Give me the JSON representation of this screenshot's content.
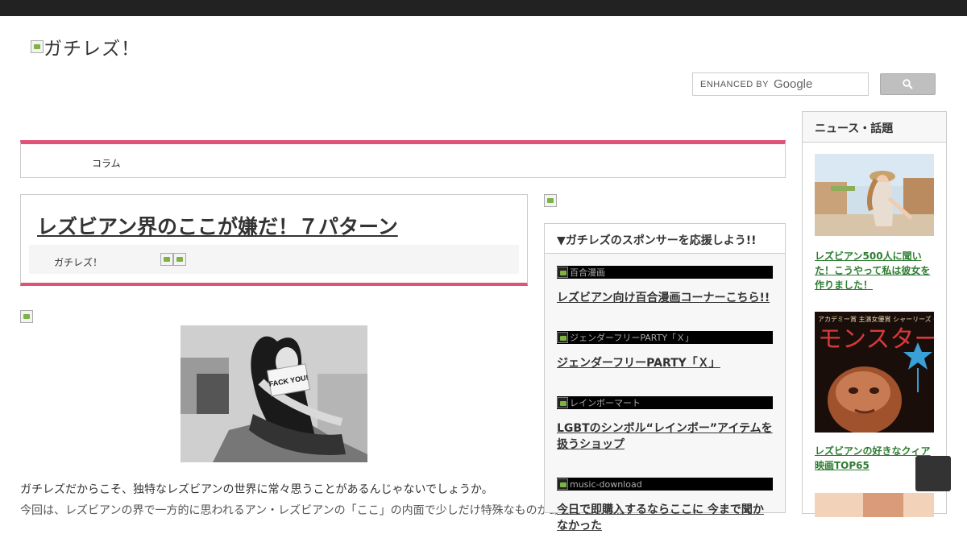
{
  "site": {
    "logo_text": "ガチレズ！"
  },
  "search": {
    "placeholder": "ENHANCED BY",
    "brand": "Google",
    "button_icon": "search-icon"
  },
  "nav": {
    "items": [
      {
        "label": "コラム"
      }
    ]
  },
  "article": {
    "title": "レズビアン界のここが嫌だ！７パターン",
    "author": "ガチレズ！",
    "card_text": "FACK YOU!",
    "intro": "ガチレズだからこそ、独特なレズビアンの世界に常々思うことがあるんじゃないでしょうか。",
    "intro2": "今回は、レズビアンの界で一方的に思われるアン・レズビアンの「ここ」の内面で少しだけ特殊なものがあるでしょうか。"
  },
  "sponsor": {
    "heading": "▼ガチレズのスポンサーを応援しよう!!",
    "items": [
      {
        "img_alt": "百合漫画",
        "link": "レズビアン向け百合漫画コーナーこちら!!"
      },
      {
        "img_alt": "ジェンダーフリーPARTY「Ｘ」",
        "link": "ジェンダーフリーPARTY「Ｘ」"
      },
      {
        "img_alt": "レインボーマート",
        "link": "LGBTのシンボル“レインボー”アイテムを扱うショップ"
      },
      {
        "img_alt": "music-download",
        "link": "今日で即購入するならここに 今まで聞かなかった"
      }
    ]
  },
  "news": {
    "heading": "ニュース・話題",
    "items": [
      {
        "link": "レズビアン500人に聞いた！こうやって私は彼女を作りました！"
      },
      {
        "poster_title": "モンスター",
        "poster_top": "アカデミー賞 主演女優賞 シャーリーズ・セロン",
        "link": "レズビアンの好きなクィア映画TOP65"
      }
    ]
  }
}
